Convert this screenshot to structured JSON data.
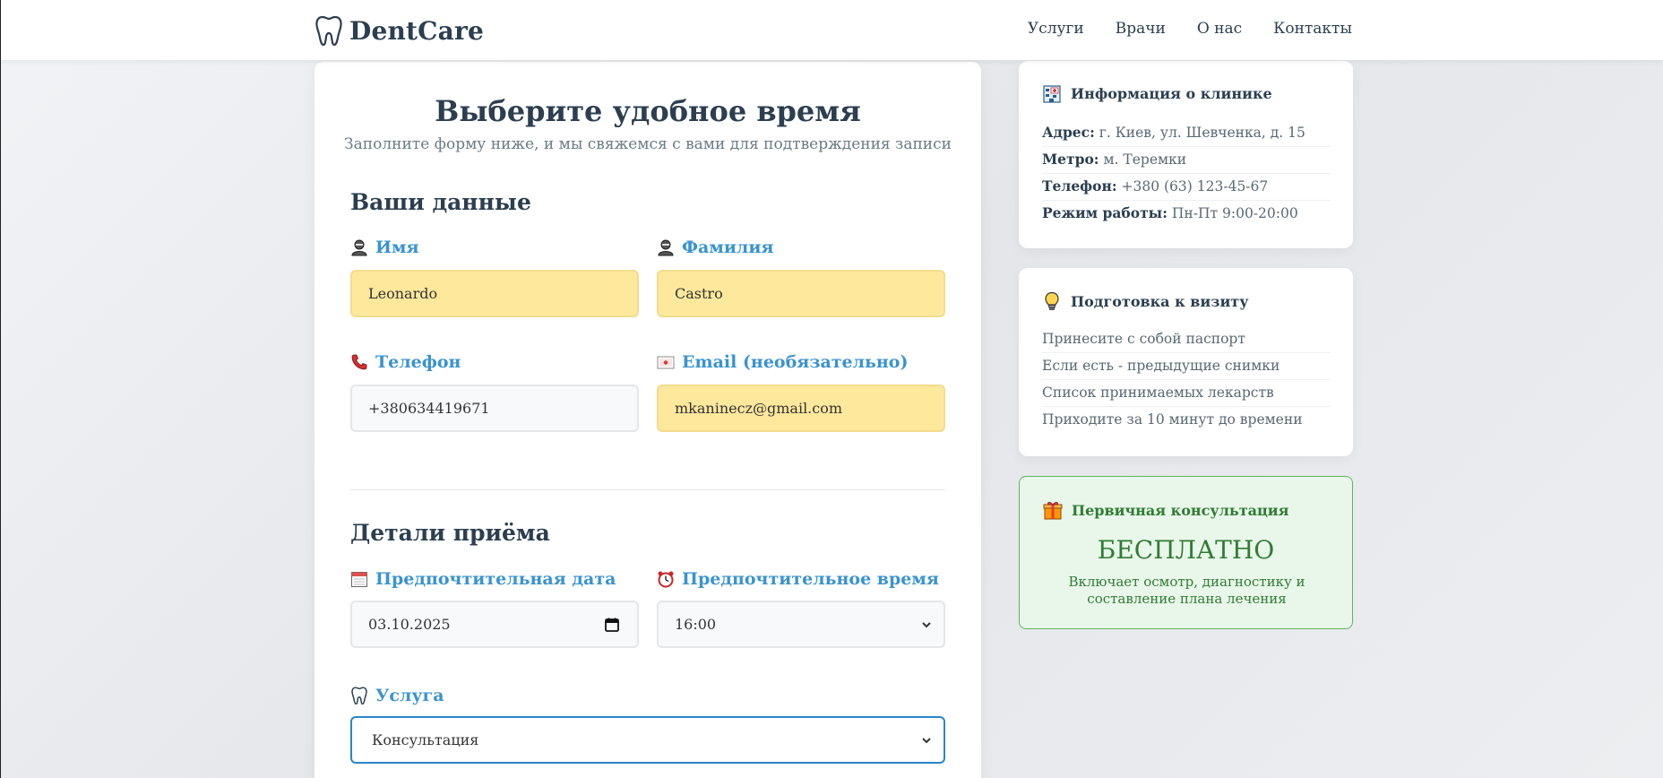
{
  "header": {
    "brand": "DentCare",
    "nav": [
      "Услуги",
      "Врачи",
      "О нас",
      "Контакты"
    ]
  },
  "form": {
    "title": "Выберите удобное время",
    "subtitle": "Заполните форму ниже, и мы свяжемся с вами для подтверждения записи",
    "section_personal": "Ваши данные",
    "first_name": {
      "label": "Имя",
      "value": "Leonardo"
    },
    "last_name": {
      "label": "Фамилия",
      "value": "Castro"
    },
    "phone": {
      "label": "Телефон",
      "value": "+380634419671"
    },
    "email": {
      "label": "Email (необязательно)",
      "value": "mkaninecz@gmail.com"
    },
    "section_details": "Детали приёма",
    "date": {
      "label": "Предпочтительная дата",
      "value": "03.10.2025"
    },
    "time": {
      "label": "Предпочтительное время",
      "value": "16:00"
    },
    "service": {
      "label": "Услуга",
      "value": "Консультация"
    }
  },
  "sidebar": {
    "clinic_info": {
      "title": "Информация о клинике",
      "rows": [
        {
          "key": "Адрес:",
          "value": "г. Киев, ул. Шевченка, д. 15"
        },
        {
          "key": "Метро:",
          "value": "м. Теремки"
        },
        {
          "key": "Телефон:",
          "value": "+380 (63) 123-45-67"
        },
        {
          "key": "Режим работы:",
          "value": "Пн-Пт 9:00-20:00"
        }
      ]
    },
    "preparation": {
      "title": "Подготовка к визиту",
      "items": [
        "Принесите с собой паспорт",
        "Если есть - предыдущие снимки",
        "Список принимаемых лекарств",
        "Приходите за 10 минут до времени"
      ]
    },
    "promo": {
      "title": "Первичная консультация",
      "big": "БЕСПЛАТНО",
      "text": "Включает осмотр, диагностику и составление плана лечения"
    }
  },
  "colors": {
    "accent": "#3a93d0",
    "filled_field": "#fde89c",
    "promo_green": "#2e7d32"
  },
  "icons": [
    "tooth-icon",
    "person-icon",
    "phone-icon",
    "envelope-icon",
    "calendar-icon",
    "alarm-clock-icon",
    "hospital-icon",
    "lightbulb-icon",
    "gift-icon",
    "chevron-down-icon"
  ]
}
